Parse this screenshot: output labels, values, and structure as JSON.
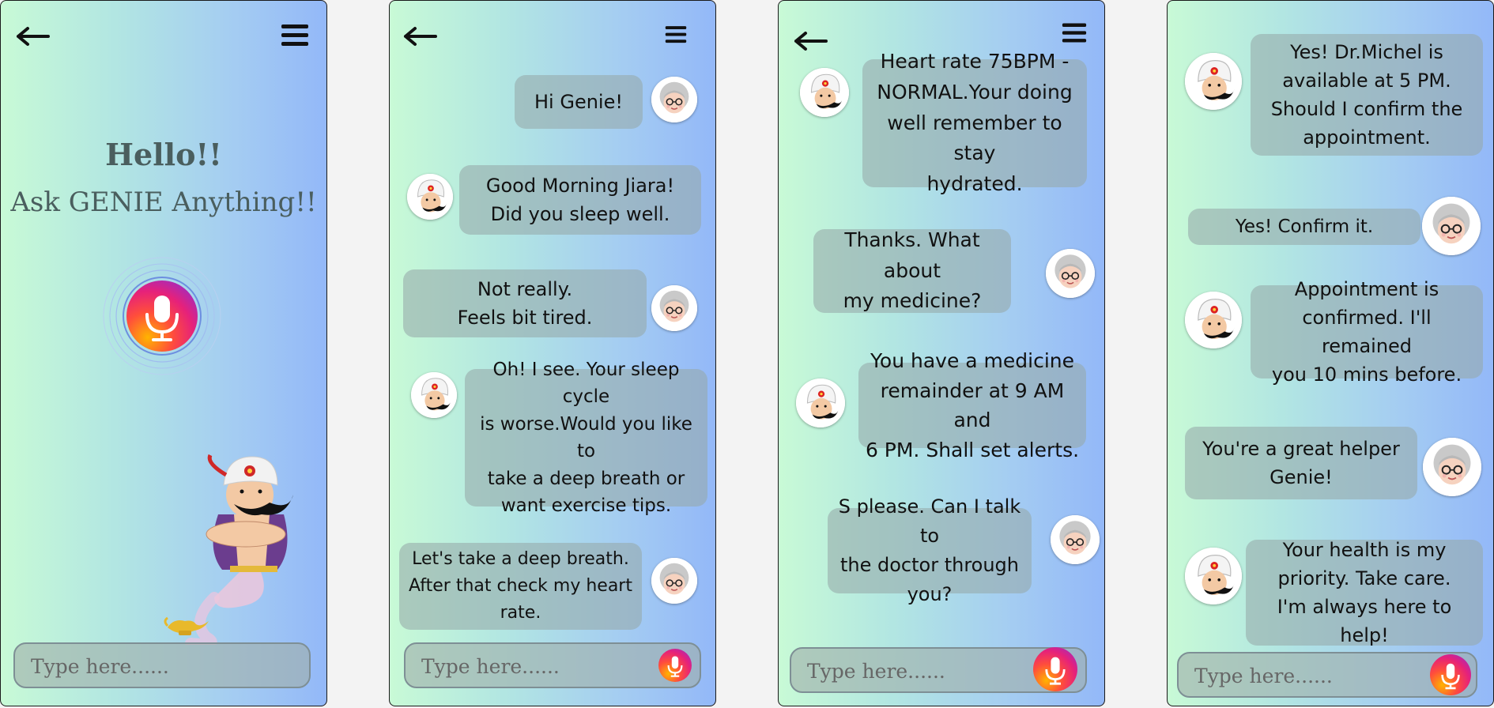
{
  "screen1": {
    "greeting": "Hello!!",
    "subtitle": "Ask GENIE Anything!!",
    "placeholder": "Type here......"
  },
  "screen2": {
    "messages": [
      "Hi Genie!",
      "Good Morning Jiara!\nDid you sleep well.",
      "Not really.\nFeels bit tired.",
      "Oh! I see. Your sleep cycle\nis worse.Would you like to\ntake a deep breath or\nwant exercise tips.",
      "Let's take a deep breath.\nAfter that check my heart\nrate."
    ],
    "placeholder": "Type here......"
  },
  "screen3": {
    "messages": [
      "Heart rate 75BPM -\nNORMAL.Your doing\nwell remember to stay\nhydrated.",
      "Thanks. What about\nmy medicine?",
      "You have a medicine\nremainder at 9 AM and\n6 PM. Shall set alerts.",
      "S please. Can I talk to\nthe doctor through\nyou?"
    ],
    "placeholder": "Type here......"
  },
  "screen4": {
    "messages": [
      "Yes! Dr.Michel is\navailable at 5 PM.\nShould I confirm the\nappointment.",
      "Yes! Confirm it.",
      "Appointment is\nconfirmed. I'll remained\nyou 10 mins before.",
      "You're a great helper\nGenie!",
      "Your health is my\npriority. Take care.\nI'm always here to help!"
    ],
    "placeholder": "Type here......"
  },
  "icons": {
    "back": "back-arrow-icon",
    "menu": "hamburger-menu-icon",
    "mic": "microphone-icon",
    "genie_avatar": "genie-avatar",
    "user_avatar": "grandmother-avatar"
  },
  "colors": {
    "gradient_left": "#c8fad6",
    "gradient_right": "#93b8f8",
    "bubble": "#96a8a8",
    "mic_orange": "#ff4e3b",
    "mic_purple": "#8a2fd6"
  }
}
